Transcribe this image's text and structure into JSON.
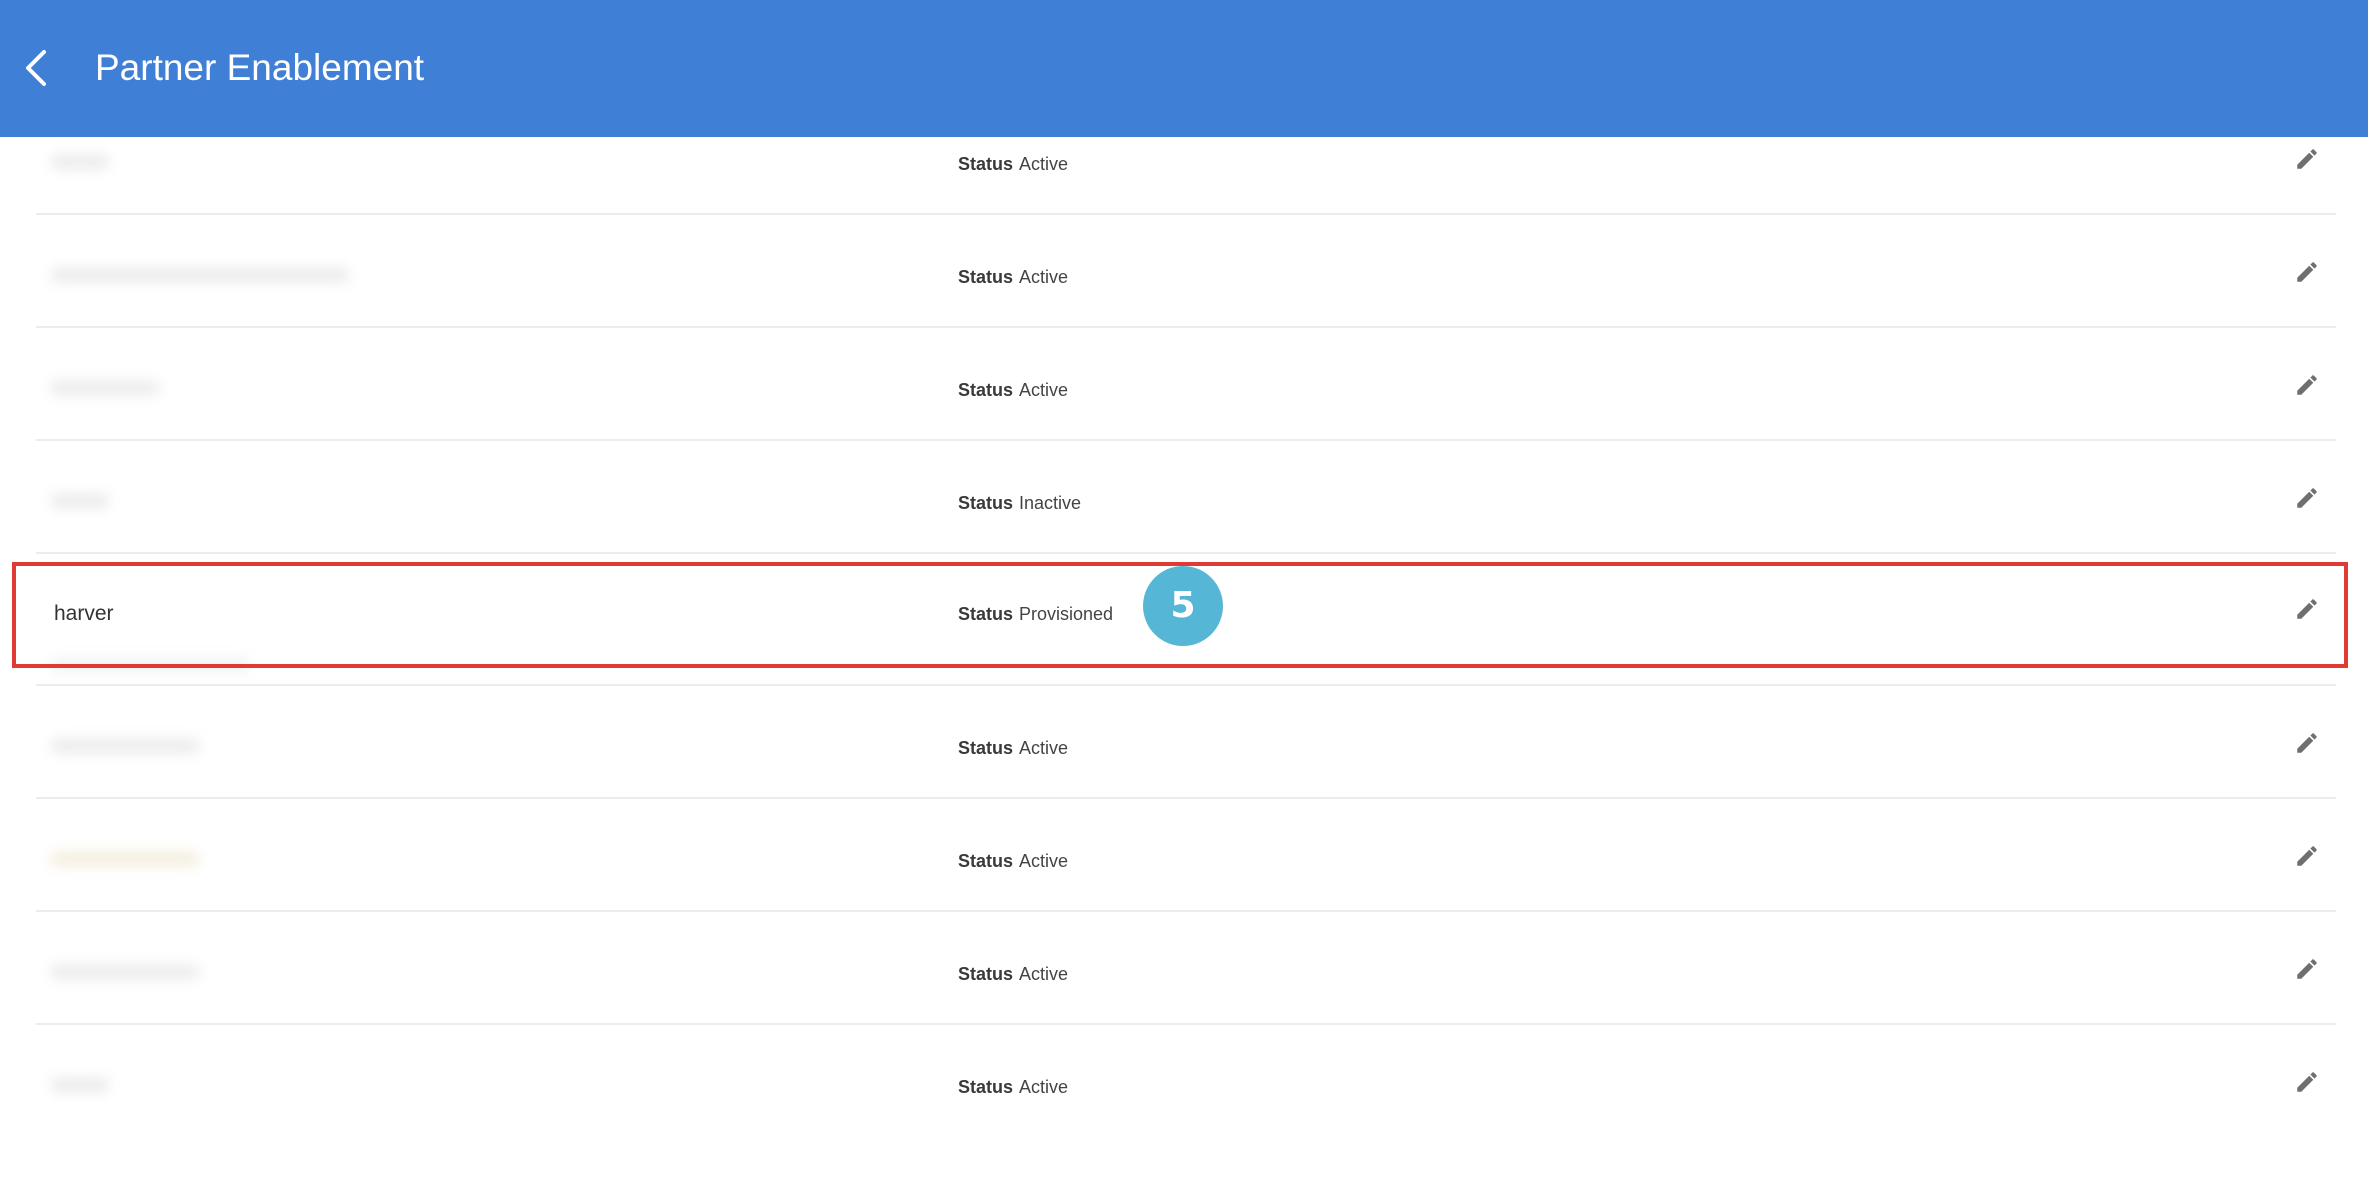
{
  "header": {
    "title": "Partner Enablement",
    "background": "#3f7fd5",
    "back_icon": "chevron-left-icon"
  },
  "list": {
    "status_label": "Status",
    "rows": [
      {
        "name": "",
        "status": "Active"
      },
      {
        "name": "",
        "status": "Active"
      },
      {
        "name": "",
        "status": "Active"
      },
      {
        "name": "",
        "status": "Inactive"
      },
      {
        "name": "harver",
        "status": "Provisioned",
        "highlighted": true
      },
      {
        "name": "",
        "status": "Active"
      },
      {
        "name": "",
        "status": "Active"
      },
      {
        "name": "",
        "status": "Active"
      },
      {
        "name": "",
        "status": "Active"
      }
    ],
    "edit_icon": "pencil-icon"
  },
  "callout": {
    "step_number": "5",
    "badge_color": "#56b6d6",
    "highlight_color": "#e03a34"
  }
}
